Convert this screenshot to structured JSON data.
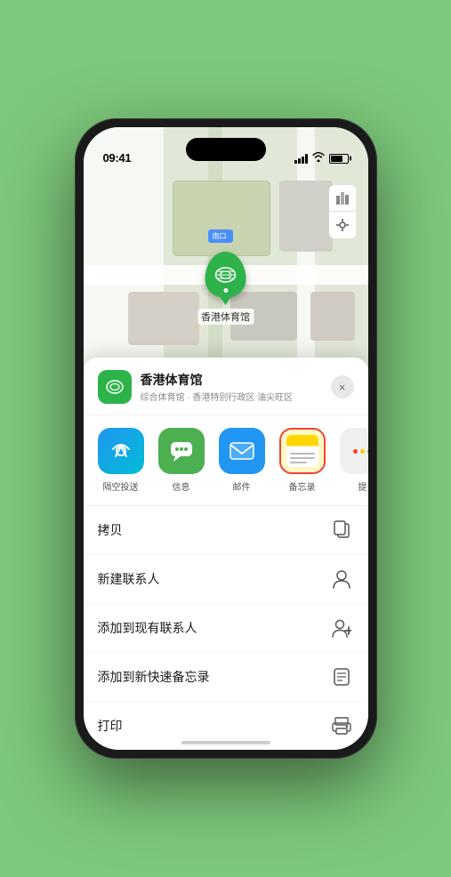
{
  "status_bar": {
    "time": "09:41",
    "location_arrow": "▶"
  },
  "map": {
    "label_nankuo": "南口",
    "marker_label": "香港体育馆",
    "controls": {
      "map_icon": "🗺",
      "location_icon": "◎"
    }
  },
  "location_card": {
    "name": "香港体育馆",
    "description": "综合体育馆 · 香港特别行政区 油尖旺区",
    "close_label": "×"
  },
  "share_items": [
    {
      "id": "airdrop",
      "label": "隔空投送",
      "emoji": "📡"
    },
    {
      "id": "message",
      "label": "信息",
      "emoji": "💬"
    },
    {
      "id": "mail",
      "label": "邮件",
      "emoji": "✉"
    },
    {
      "id": "notes",
      "label": "备忘录",
      "emoji": "📝"
    },
    {
      "id": "more",
      "label": "提",
      "emoji": "···"
    }
  ],
  "more_dots_colors": [
    "#FF3B30",
    "#FFCC00",
    "#34C759"
  ],
  "actions": [
    {
      "id": "copy",
      "label": "拷贝",
      "icon": "copy"
    },
    {
      "id": "new-contact",
      "label": "新建联系人",
      "icon": "person"
    },
    {
      "id": "add-existing",
      "label": "添加到现有联系人",
      "icon": "person-add"
    },
    {
      "id": "add-notes",
      "label": "添加到新快速备忘录",
      "icon": "note"
    },
    {
      "id": "print",
      "label": "打印",
      "icon": "print"
    }
  ]
}
